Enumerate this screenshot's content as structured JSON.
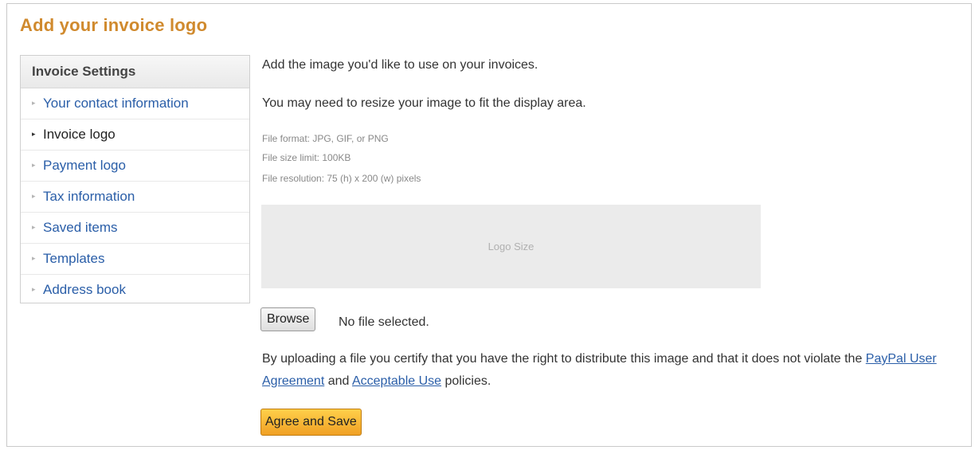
{
  "page": {
    "title": "Add your invoice logo"
  },
  "sidebar": {
    "header": "Invoice Settings",
    "active_index": 1,
    "items": [
      {
        "label": "Your contact information"
      },
      {
        "label": "Invoice logo"
      },
      {
        "label": "Payment logo"
      },
      {
        "label": "Tax information"
      },
      {
        "label": "Saved items"
      },
      {
        "label": "Templates"
      },
      {
        "label": "Address book"
      }
    ]
  },
  "main": {
    "intro_1": "Add the image you'd like to use on your invoices.",
    "intro_2": "You may need to resize your image to fit the display area.",
    "specs": {
      "format": "File format: JPG, GIF, or PNG",
      "size": "File size limit: 100KB",
      "resolution": "File resolution: 75 (h) x 200 (w) pixels"
    },
    "logo_placeholder": "Logo Size",
    "browse_label": "Browse",
    "file_status": "No file selected.",
    "legal": {
      "prefix": "By uploading a file you certify that you have the right to distribute this image and that it does not violate the",
      "link_1": "PayPal User Agreement",
      "middle": "and",
      "link_2": "Acceptable Use",
      "suffix": "policies."
    },
    "save_label": "Agree and Save"
  },
  "colors": {
    "title": "#d08a2e",
    "link": "#2a5ea8",
    "primary_button": "#f5b12f",
    "logo_box": "#ebebeb"
  }
}
